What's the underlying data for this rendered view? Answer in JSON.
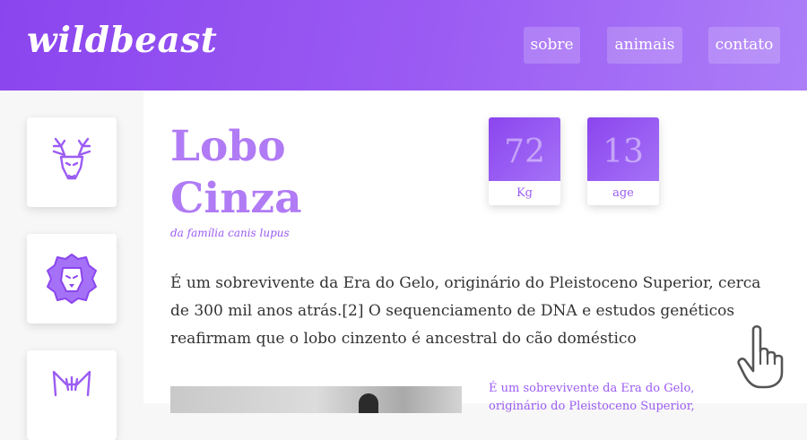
{
  "header": {
    "logo": "wildbeast",
    "nav": [
      "sobre",
      "animais",
      "contato"
    ]
  },
  "sidebar": {
    "items": [
      {
        "icon": "deer-icon"
      },
      {
        "icon": "lion-icon"
      },
      {
        "icon": "cat-icon"
      }
    ]
  },
  "animal": {
    "name_line1": "Lobo",
    "name_line2": "Cinza",
    "subtitle": "da família canis lupus",
    "stats": [
      {
        "value": "72",
        "label": "Kg"
      },
      {
        "value": "13",
        "label": "age"
      }
    ],
    "description": "É um sobrevivente da Era do Gelo, originário do Pleistoceno Superior, cerca de 300 mil anos atrás.[2] O sequenciamento de DNA e estudos genéticos reafirmam que o lobo cinzento é ancestral do cão doméstico",
    "side_text": "É um sobrevivente da Era do Gelo, originário do Pleistoceno Superior,"
  },
  "colors": {
    "primary": "#8b45ee",
    "accent": "#b07bf5",
    "text": "#333333"
  },
  "cursor": "hand-pointer-icon"
}
